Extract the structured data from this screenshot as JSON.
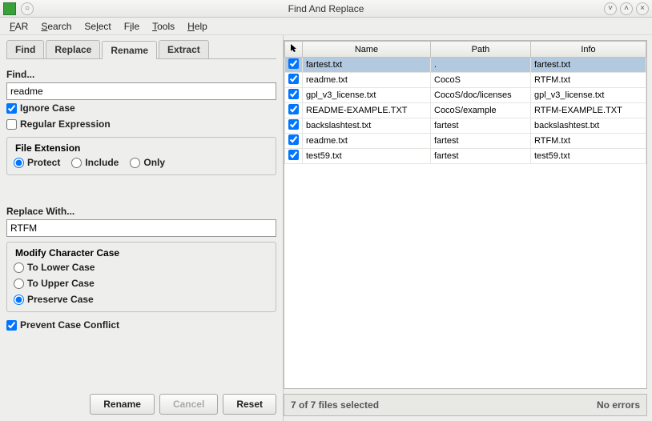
{
  "window": {
    "title": "Find And Replace"
  },
  "menu": {
    "far": "FAR",
    "search": "Search",
    "select": "Select",
    "file": "File",
    "tools": "Tools",
    "help": "Help"
  },
  "tabs": {
    "find": "Find",
    "replace": "Replace",
    "rename": "Rename",
    "extract": "Extract"
  },
  "find": {
    "label": "Find...",
    "value": "readme",
    "ignore_case": "Ignore Case",
    "regex": "Regular Expression"
  },
  "file_ext": {
    "label": "File Extension",
    "protect": "Protect",
    "include": "Include",
    "only": "Only"
  },
  "replace": {
    "label": "Replace With...",
    "value": "RTFM"
  },
  "case_mod": {
    "label": "Modify Character Case",
    "lower": "To Lower Case",
    "upper": "To Upper Case",
    "preserve": "Preserve Case"
  },
  "prevent": "Prevent Case Conflict",
  "buttons": {
    "rename": "Rename",
    "cancel": "Cancel",
    "reset": "Reset"
  },
  "table": {
    "col_name": "Name",
    "col_path": "Path",
    "col_info": "Info",
    "rows": [
      {
        "checked": true,
        "selected": true,
        "name": "fartest.txt",
        "path": ".",
        "info": "fartest.txt"
      },
      {
        "checked": true,
        "selected": false,
        "name": "readme.txt",
        "path": "CocoS",
        "info": "RTFM.txt"
      },
      {
        "checked": true,
        "selected": false,
        "name": "gpl_v3_license.txt",
        "path": "CocoS/doc/licenses",
        "info": "gpl_v3_license.txt"
      },
      {
        "checked": true,
        "selected": false,
        "name": "README-EXAMPLE.TXT",
        "path": "CocoS/example",
        "info": "RTFM-EXAMPLE.TXT"
      },
      {
        "checked": true,
        "selected": false,
        "name": "backslashtest.txt",
        "path": "fartest",
        "info": "backslashtest.txt"
      },
      {
        "checked": true,
        "selected": false,
        "name": "readme.txt",
        "path": "fartest",
        "info": "RTFM.txt"
      },
      {
        "checked": true,
        "selected": false,
        "name": "test59.txt",
        "path": "fartest",
        "info": "test59.txt"
      }
    ]
  },
  "status": {
    "left": "7 of 7 files selected",
    "right": "No errors"
  }
}
